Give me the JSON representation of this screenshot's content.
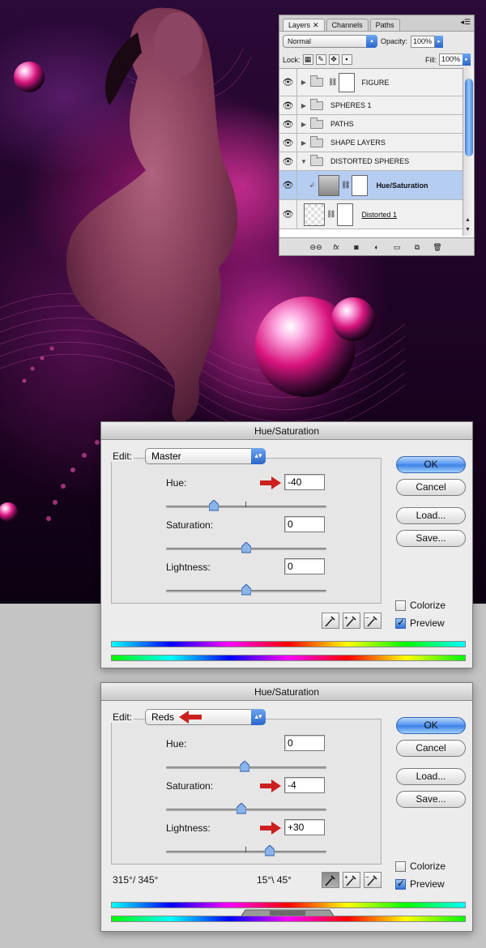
{
  "layers_panel": {
    "tabs": [
      {
        "label": "Layers",
        "active": true
      },
      {
        "label": "Channels",
        "active": false
      },
      {
        "label": "Paths",
        "active": false
      }
    ],
    "blend_mode": "Normal",
    "opacity_label": "Opacity:",
    "opacity_value": "100%",
    "lock_label": "Lock:",
    "fill_label": "Fill:",
    "fill_value": "100%",
    "layers": [
      {
        "name": "FIGURE",
        "type": "group-with-mask",
        "visible": true,
        "expanded": false
      },
      {
        "name": "SPHERES 1",
        "type": "group",
        "visible": true,
        "expanded": false
      },
      {
        "name": "PATHS",
        "type": "group",
        "visible": true,
        "expanded": false
      },
      {
        "name": "SHAPE LAYERS",
        "type": "group",
        "visible": true,
        "expanded": false
      },
      {
        "name": "DISTORTED SPHERES",
        "type": "group",
        "visible": true,
        "expanded": true
      },
      {
        "name": "Hue/Saturation",
        "type": "adjustment",
        "visible": true,
        "selected": true
      },
      {
        "name": "Distorted 1",
        "type": "layer",
        "visible": true
      }
    ],
    "bottom_buttons": [
      "link-icon",
      "fx-icon",
      "mask-icon",
      "adjustment-icon",
      "new-group-icon",
      "new-layer-icon",
      "trash-icon"
    ]
  },
  "dialog1": {
    "title": "Hue/Saturation",
    "edit_label": "Edit:",
    "edit_value": "Master",
    "hue_label": "Hue:",
    "hue_value": "-40",
    "saturation_label": "Saturation:",
    "saturation_value": "0",
    "lightness_label": "Lightness:",
    "lightness_value": "0",
    "ok_label": "OK",
    "cancel_label": "Cancel",
    "load_label": "Load...",
    "save_label": "Save...",
    "colorize_label": "Colorize",
    "colorize_checked": false,
    "preview_label": "Preview",
    "preview_checked": true
  },
  "dialog2": {
    "title": "Hue/Saturation",
    "edit_label": "Edit:",
    "edit_value": "Reds",
    "hue_label": "Hue:",
    "hue_value": "0",
    "saturation_label": "Saturation:",
    "saturation_value": "-4",
    "lightness_label": "Lightness:",
    "lightness_value": "+30",
    "ok_label": "OK",
    "cancel_label": "Cancel",
    "load_label": "Load...",
    "save_label": "Save...",
    "colorize_label": "Colorize",
    "colorize_checked": false,
    "preview_label": "Preview",
    "preview_checked": true,
    "range_left": "315°/ 345°",
    "range_right": "15°\\ 45°"
  },
  "colors": {
    "accent_blue": "#3b7fe4",
    "arrow_red": "#cc1f1f",
    "selected_row": "#b6cdf2"
  }
}
